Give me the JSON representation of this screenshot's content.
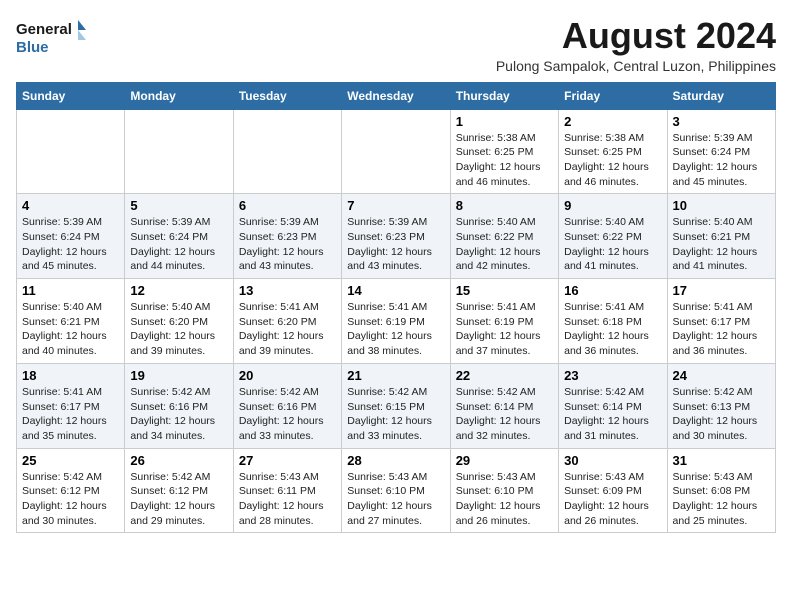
{
  "logo": {
    "line1": "General",
    "line2": "Blue"
  },
  "title": "August 2024",
  "subtitle": "Pulong Sampalok, Central Luzon, Philippines",
  "days_of_week": [
    "Sunday",
    "Monday",
    "Tuesday",
    "Wednesday",
    "Thursday",
    "Friday",
    "Saturday"
  ],
  "weeks": [
    [
      {
        "day": "",
        "info": ""
      },
      {
        "day": "",
        "info": ""
      },
      {
        "day": "",
        "info": ""
      },
      {
        "day": "",
        "info": ""
      },
      {
        "day": "1",
        "info": "Sunrise: 5:38 AM\nSunset: 6:25 PM\nDaylight: 12 hours\nand 46 minutes."
      },
      {
        "day": "2",
        "info": "Sunrise: 5:38 AM\nSunset: 6:25 PM\nDaylight: 12 hours\nand 46 minutes."
      },
      {
        "day": "3",
        "info": "Sunrise: 5:39 AM\nSunset: 6:24 PM\nDaylight: 12 hours\nand 45 minutes."
      }
    ],
    [
      {
        "day": "4",
        "info": "Sunrise: 5:39 AM\nSunset: 6:24 PM\nDaylight: 12 hours\nand 45 minutes."
      },
      {
        "day": "5",
        "info": "Sunrise: 5:39 AM\nSunset: 6:24 PM\nDaylight: 12 hours\nand 44 minutes."
      },
      {
        "day": "6",
        "info": "Sunrise: 5:39 AM\nSunset: 6:23 PM\nDaylight: 12 hours\nand 43 minutes."
      },
      {
        "day": "7",
        "info": "Sunrise: 5:39 AM\nSunset: 6:23 PM\nDaylight: 12 hours\nand 43 minutes."
      },
      {
        "day": "8",
        "info": "Sunrise: 5:40 AM\nSunset: 6:22 PM\nDaylight: 12 hours\nand 42 minutes."
      },
      {
        "day": "9",
        "info": "Sunrise: 5:40 AM\nSunset: 6:22 PM\nDaylight: 12 hours\nand 41 minutes."
      },
      {
        "day": "10",
        "info": "Sunrise: 5:40 AM\nSunset: 6:21 PM\nDaylight: 12 hours\nand 41 minutes."
      }
    ],
    [
      {
        "day": "11",
        "info": "Sunrise: 5:40 AM\nSunset: 6:21 PM\nDaylight: 12 hours\nand 40 minutes."
      },
      {
        "day": "12",
        "info": "Sunrise: 5:40 AM\nSunset: 6:20 PM\nDaylight: 12 hours\nand 39 minutes."
      },
      {
        "day": "13",
        "info": "Sunrise: 5:41 AM\nSunset: 6:20 PM\nDaylight: 12 hours\nand 39 minutes."
      },
      {
        "day": "14",
        "info": "Sunrise: 5:41 AM\nSunset: 6:19 PM\nDaylight: 12 hours\nand 38 minutes."
      },
      {
        "day": "15",
        "info": "Sunrise: 5:41 AM\nSunset: 6:19 PM\nDaylight: 12 hours\nand 37 minutes."
      },
      {
        "day": "16",
        "info": "Sunrise: 5:41 AM\nSunset: 6:18 PM\nDaylight: 12 hours\nand 36 minutes."
      },
      {
        "day": "17",
        "info": "Sunrise: 5:41 AM\nSunset: 6:17 PM\nDaylight: 12 hours\nand 36 minutes."
      }
    ],
    [
      {
        "day": "18",
        "info": "Sunrise: 5:41 AM\nSunset: 6:17 PM\nDaylight: 12 hours\nand 35 minutes."
      },
      {
        "day": "19",
        "info": "Sunrise: 5:42 AM\nSunset: 6:16 PM\nDaylight: 12 hours\nand 34 minutes."
      },
      {
        "day": "20",
        "info": "Sunrise: 5:42 AM\nSunset: 6:16 PM\nDaylight: 12 hours\nand 33 minutes."
      },
      {
        "day": "21",
        "info": "Sunrise: 5:42 AM\nSunset: 6:15 PM\nDaylight: 12 hours\nand 33 minutes."
      },
      {
        "day": "22",
        "info": "Sunrise: 5:42 AM\nSunset: 6:14 PM\nDaylight: 12 hours\nand 32 minutes."
      },
      {
        "day": "23",
        "info": "Sunrise: 5:42 AM\nSunset: 6:14 PM\nDaylight: 12 hours\nand 31 minutes."
      },
      {
        "day": "24",
        "info": "Sunrise: 5:42 AM\nSunset: 6:13 PM\nDaylight: 12 hours\nand 30 minutes."
      }
    ],
    [
      {
        "day": "25",
        "info": "Sunrise: 5:42 AM\nSunset: 6:12 PM\nDaylight: 12 hours\nand 30 minutes."
      },
      {
        "day": "26",
        "info": "Sunrise: 5:42 AM\nSunset: 6:12 PM\nDaylight: 12 hours\nand 29 minutes."
      },
      {
        "day": "27",
        "info": "Sunrise: 5:43 AM\nSunset: 6:11 PM\nDaylight: 12 hours\nand 28 minutes."
      },
      {
        "day": "28",
        "info": "Sunrise: 5:43 AM\nSunset: 6:10 PM\nDaylight: 12 hours\nand 27 minutes."
      },
      {
        "day": "29",
        "info": "Sunrise: 5:43 AM\nSunset: 6:10 PM\nDaylight: 12 hours\nand 26 minutes."
      },
      {
        "day": "30",
        "info": "Sunrise: 5:43 AM\nSunset: 6:09 PM\nDaylight: 12 hours\nand 26 minutes."
      },
      {
        "day": "31",
        "info": "Sunrise: 5:43 AM\nSunset: 6:08 PM\nDaylight: 12 hours\nand 25 minutes."
      }
    ]
  ]
}
